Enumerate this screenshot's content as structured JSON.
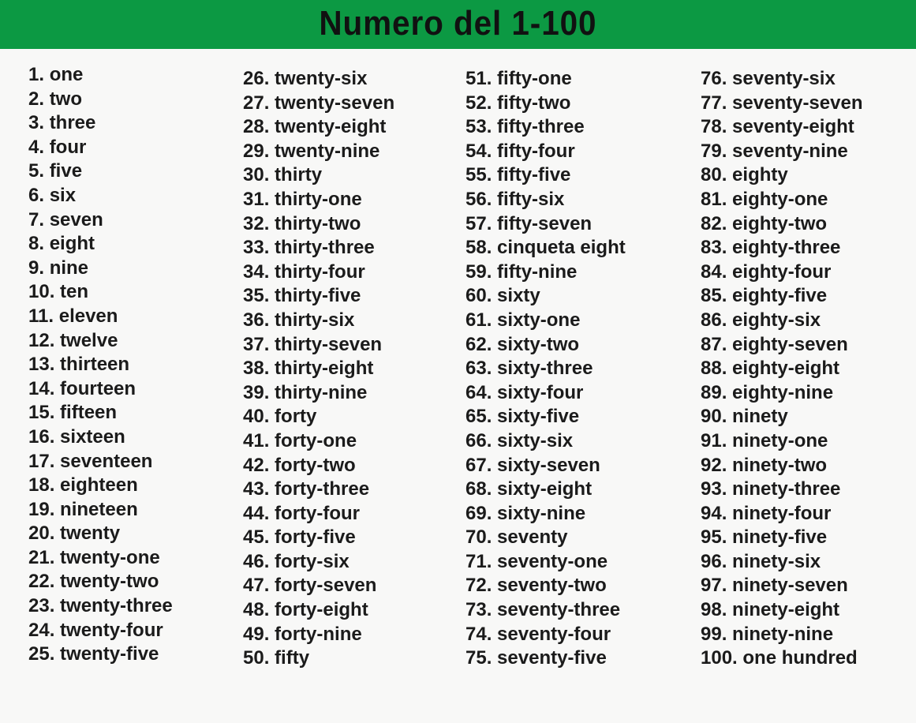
{
  "header": {
    "title": "Numero del 1-100",
    "background_color": "#0c9943",
    "text_color": "#111111"
  },
  "page": {
    "background_color": "#f8f8f7",
    "text_color": "#1b1b1b"
  },
  "columns": [
    {
      "id": "column-1",
      "items": [
        {
          "index": "1.",
          "word": "one"
        },
        {
          "index": "2.",
          "word": "two"
        },
        {
          "index": "3.",
          "word": "three"
        },
        {
          "index": "4.",
          "word": "four"
        },
        {
          "index": "5.",
          "word": "five"
        },
        {
          "index": "6.",
          "word": "six"
        },
        {
          "index": "7.",
          "word": "seven"
        },
        {
          "index": "8.",
          "word": "eight"
        },
        {
          "index": "9.",
          "word": "nine"
        },
        {
          "index": "10.",
          "word": "ten"
        },
        {
          "index": "11.",
          "word": "eleven"
        },
        {
          "index": "12.",
          "word": "twelve"
        },
        {
          "index": "13.",
          "word": "thirteen"
        },
        {
          "index": "14.",
          "word": "fourteen"
        },
        {
          "index": "15.",
          "word": "fifteen"
        },
        {
          "index": "16.",
          "word": "sixteen"
        },
        {
          "index": "17.",
          "word": "seventeen"
        },
        {
          "index": "18.",
          "word": "eighteen"
        },
        {
          "index": "19.",
          "word": "nineteen"
        },
        {
          "index": "20.",
          "word": "twenty"
        },
        {
          "index": "21.",
          "word": "twenty-one"
        },
        {
          "index": "22.",
          "word": "twenty-two"
        },
        {
          "index": "23.",
          "word": "twenty-three"
        },
        {
          "index": "24.",
          "word": "twenty-four"
        },
        {
          "index": "25.",
          "word": "twenty-five"
        }
      ]
    },
    {
      "id": "column-2",
      "items": [
        {
          "index": "26.",
          "word": "twenty-six"
        },
        {
          "index": "27.",
          "word": "twenty-seven"
        },
        {
          "index": "28.",
          "word": "twenty-eight"
        },
        {
          "index": "29.",
          "word": "twenty-nine"
        },
        {
          "index": "30.",
          "word": "thirty"
        },
        {
          "index": "31.",
          "word": "thirty-one"
        },
        {
          "index": "32.",
          "word": "thirty-two"
        },
        {
          "index": "33.",
          "word": "thirty-three"
        },
        {
          "index": "34.",
          "word": "thirty-four"
        },
        {
          "index": "35.",
          "word": "thirty-five"
        },
        {
          "index": "36.",
          "word": "thirty-six"
        },
        {
          "index": "37.",
          "word": "thirty-seven"
        },
        {
          "index": "38.",
          "word": "thirty-eight"
        },
        {
          "index": "39.",
          "word": "thirty-nine"
        },
        {
          "index": "40.",
          "word": "forty"
        },
        {
          "index": "41.",
          "word": "forty-one"
        },
        {
          "index": "42.",
          "word": "forty-two"
        },
        {
          "index": "43.",
          "word": "forty-three"
        },
        {
          "index": "44.",
          "word": "forty-four"
        },
        {
          "index": "45.",
          "word": "forty-five"
        },
        {
          "index": "46.",
          "word": "forty-six"
        },
        {
          "index": "47.",
          "word": "forty-seven"
        },
        {
          "index": "48.",
          "word": "forty-eight"
        },
        {
          "index": "49.",
          "word": "forty-nine"
        },
        {
          "index": "50.",
          "word": "fifty"
        }
      ]
    },
    {
      "id": "column-3",
      "items": [
        {
          "index": "51.",
          "word": "fifty-one"
        },
        {
          "index": "52.",
          "word": "fifty-two"
        },
        {
          "index": "53.",
          "word": "fifty-three"
        },
        {
          "index": "54.",
          "word": "fifty-four"
        },
        {
          "index": "55.",
          "word": "fifty-five"
        },
        {
          "index": "56.",
          "word": "fifty-six"
        },
        {
          "index": "57.",
          "word": "fifty-seven"
        },
        {
          "index": "58.",
          "word": "cinqueta eight"
        },
        {
          "index": "59.",
          "word": "fifty-nine"
        },
        {
          "index": "60.",
          "word": "sixty"
        },
        {
          "index": "61.",
          "word": "sixty-one"
        },
        {
          "index": "62.",
          "word": "sixty-two"
        },
        {
          "index": "63.",
          "word": "sixty-three"
        },
        {
          "index": "64.",
          "word": "sixty-four"
        },
        {
          "index": "65.",
          "word": "sixty-five"
        },
        {
          "index": "66.",
          "word": "sixty-six"
        },
        {
          "index": "67.",
          "word": "sixty-seven"
        },
        {
          "index": "68.",
          "word": "sixty-eight"
        },
        {
          "index": "69.",
          "word": "sixty-nine"
        },
        {
          "index": "70.",
          "word": "seventy"
        },
        {
          "index": "71.",
          "word": "seventy-one"
        },
        {
          "index": "72.",
          "word": "seventy-two"
        },
        {
          "index": "73.",
          "word": "seventy-three"
        },
        {
          "index": "74.",
          "word": "seventy-four"
        },
        {
          "index": "75.",
          "word": "seventy-five"
        }
      ]
    },
    {
      "id": "column-4",
      "items": [
        {
          "index": "76.",
          "word": "seventy-six"
        },
        {
          "index": "77.",
          "word": "seventy-seven"
        },
        {
          "index": "78.",
          "word": "seventy-eight"
        },
        {
          "index": "79.",
          "word": "seventy-nine"
        },
        {
          "index": "80.",
          "word": "eighty"
        },
        {
          "index": "81.",
          "word": "eighty-one"
        },
        {
          "index": "82.",
          "word": "eighty-two"
        },
        {
          "index": "83.",
          "word": "eighty-three"
        },
        {
          "index": "84.",
          "word": "eighty-four"
        },
        {
          "index": "85.",
          "word": "eighty-five"
        },
        {
          "index": "86.",
          "word": "eighty-six"
        },
        {
          "index": "87.",
          "word": "eighty-seven"
        },
        {
          "index": "88.",
          "word": "eighty-eight"
        },
        {
          "index": "89.",
          "word": "eighty-nine"
        },
        {
          "index": "90.",
          "word": "ninety"
        },
        {
          "index": "91.",
          "word": "ninety-one"
        },
        {
          "index": "92.",
          "word": "ninety-two"
        },
        {
          "index": "93.",
          "word": "ninety-three"
        },
        {
          "index": "94.",
          "word": "ninety-four"
        },
        {
          "index": "95.",
          "word": "ninety-five"
        },
        {
          "index": "96.",
          "word": "ninety-six"
        },
        {
          "index": "97.",
          "word": "ninety-seven"
        },
        {
          "index": "98.",
          "word": "ninety-eight"
        },
        {
          "index": "99.",
          "word": "ninety-nine"
        },
        {
          "index": "100.",
          "word": "one hundred"
        }
      ]
    }
  ]
}
